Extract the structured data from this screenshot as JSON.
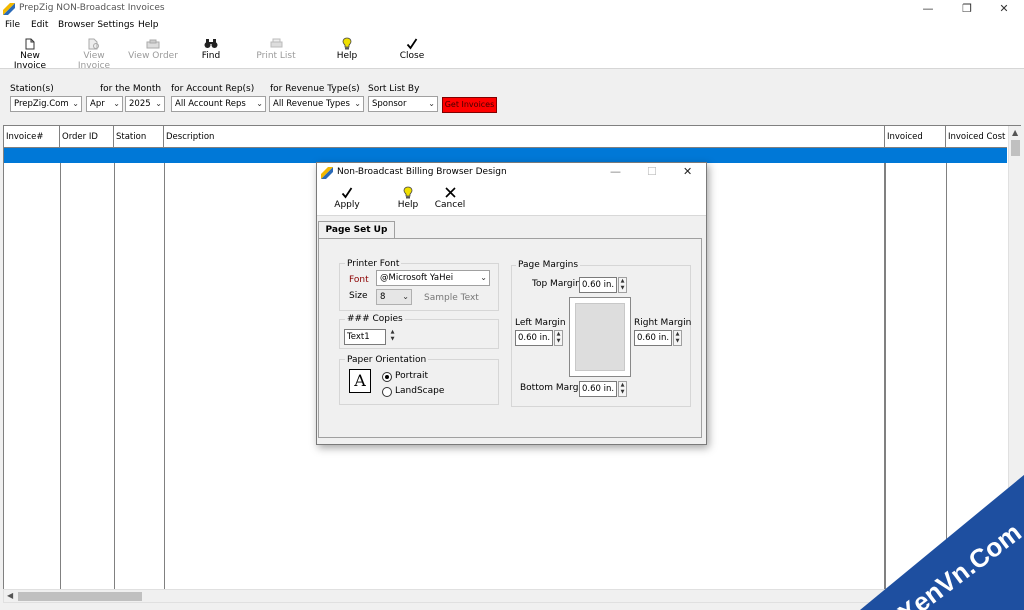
{
  "window": {
    "title": "PrepZig NON-Broadcast Invoices"
  },
  "menu": [
    "File",
    "Edit",
    "Browser Settings",
    "Help"
  ],
  "toolbar": {
    "new_invoice": "New Invoice",
    "view_invoice": "View Invoice",
    "view_order": "View Order",
    "find": "Find",
    "print_list": "Print List",
    "help": "Help",
    "close": "Close"
  },
  "filters": {
    "station_label": "Station(s)",
    "station_value": "PrepZig.Com",
    "month_label": "for the Month",
    "month_value": "Apr",
    "year_value": "2025",
    "rep_label": "for Account Rep(s)",
    "rep_value": "All Account Reps",
    "revenue_label": "for Revenue Type(s)",
    "revenue_value": "All Revenue Types",
    "sort_label": "Sort List By",
    "sort_value": "Sponsor",
    "get_invoices": "Get Invoices"
  },
  "table": {
    "columns": [
      "Invoice#",
      "Order ID",
      "Station",
      "Description",
      "Invoiced Items",
      "Invoiced Cost"
    ]
  },
  "dialog": {
    "title": "Non-Broadcast Billing Browser Design",
    "apply": "Apply",
    "help": "Help",
    "cancel": "Cancel",
    "tab": "Page Set Up",
    "printer_font_label": "Printer Font",
    "font_label": "Font",
    "font_value": "@Microsoft YaHei",
    "size_label": "Size",
    "size_value": "8",
    "sample_text": "Sample Text",
    "copies_label": "### Copies",
    "copies_value": "Text1",
    "orientation_label": "Paper Orientation",
    "orientation_icon_letter": "A",
    "portrait": "Portrait",
    "landscape": "LandScape",
    "margins_label": "Page Margins",
    "top_margin_label": "Top Margin",
    "top_margin": "0.60 in.",
    "left_margin_label": "Left Margin",
    "left_margin": "0.60 in.",
    "right_margin_label": "Right Margin",
    "right_margin": "0.60 in.",
    "bottom_margin_label": "Bottom Margin",
    "bottom_margin": "0.60 in."
  },
  "watermark": {
    "text": "XenVn.Com"
  },
  "colors": {
    "selection": "#0078d7",
    "get_button": "#ff0000",
    "font_label": "#8b0000",
    "watermark": "#1e4fa0"
  }
}
